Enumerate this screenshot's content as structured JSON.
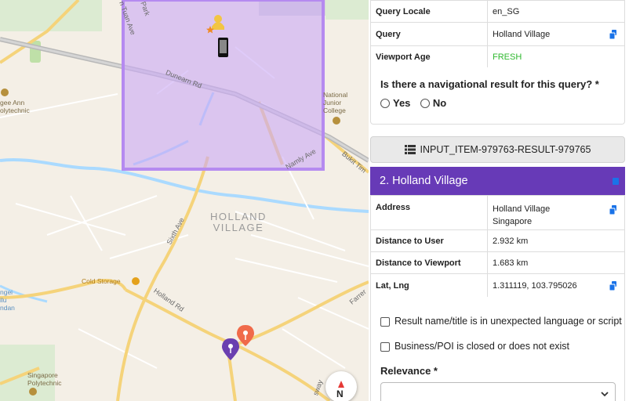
{
  "map": {
    "road_labels": {
      "dunearn": "Dunearn Rd",
      "sixth": "Sixth Ave",
      "holland": "Holland Rd",
      "namly": "Namly Ave",
      "bukit": "Bukit Tim",
      "farrer": "Farrer",
      "tuan": "n Tuan Ave",
      "park": "Park",
      "swat": "sway"
    },
    "area_label": [
      "HOLLAND",
      "VILLAGE"
    ],
    "poi_labels": {
      "ngee_ann": [
        "gee Ann",
        "olytechnic"
      ],
      "national_junior": [
        "National",
        "Junior",
        "College"
      ],
      "cold_storage": "Cold Storage",
      "singapore_poly": [
        "Singapore",
        "Polytechnic"
      ],
      "left_edge": [
        "ngei",
        "ilu",
        "ndan"
      ]
    },
    "compass_letter": "N",
    "colors": {
      "viewport_fill": "#c9a8f5",
      "viewport_border": "#b58af0",
      "marker_orange": "#f06a4a",
      "marker_purple": "#6a3fb0"
    }
  },
  "query_table": [
    {
      "key": "Query Locale",
      "value": "en_SG",
      "copy": false
    },
    {
      "key": "Query",
      "value": "Holland Village",
      "copy": true
    },
    {
      "key": "Viewport Age",
      "value": "FRESH",
      "copy": false,
      "color": "#2eb82e"
    }
  ],
  "nav_question": {
    "text": "Is there a navigational result for this query? *",
    "options": [
      "Yes",
      "No"
    ]
  },
  "input_item_button": "INPUT_ITEM-979763-RESULT-979765",
  "result": {
    "header": "2. Holland Village",
    "header_color": "#673ab7",
    "rows": [
      {
        "key": "Address",
        "value_lines": [
          "Holland Village",
          "Singapore"
        ],
        "copy": true
      },
      {
        "key": "Distance to User",
        "value": "2.932 km",
        "copy": false
      },
      {
        "key": "Distance to Viewport",
        "value": "1.683 km",
        "copy": false
      },
      {
        "key": "Lat, Lng",
        "value": "1.311119, 103.795026",
        "copy": true
      }
    ],
    "checks": [
      "Result name/title is in unexpected language or script",
      "Business/POI is closed or does not exist"
    ],
    "relevance_label": "Relevance *"
  }
}
